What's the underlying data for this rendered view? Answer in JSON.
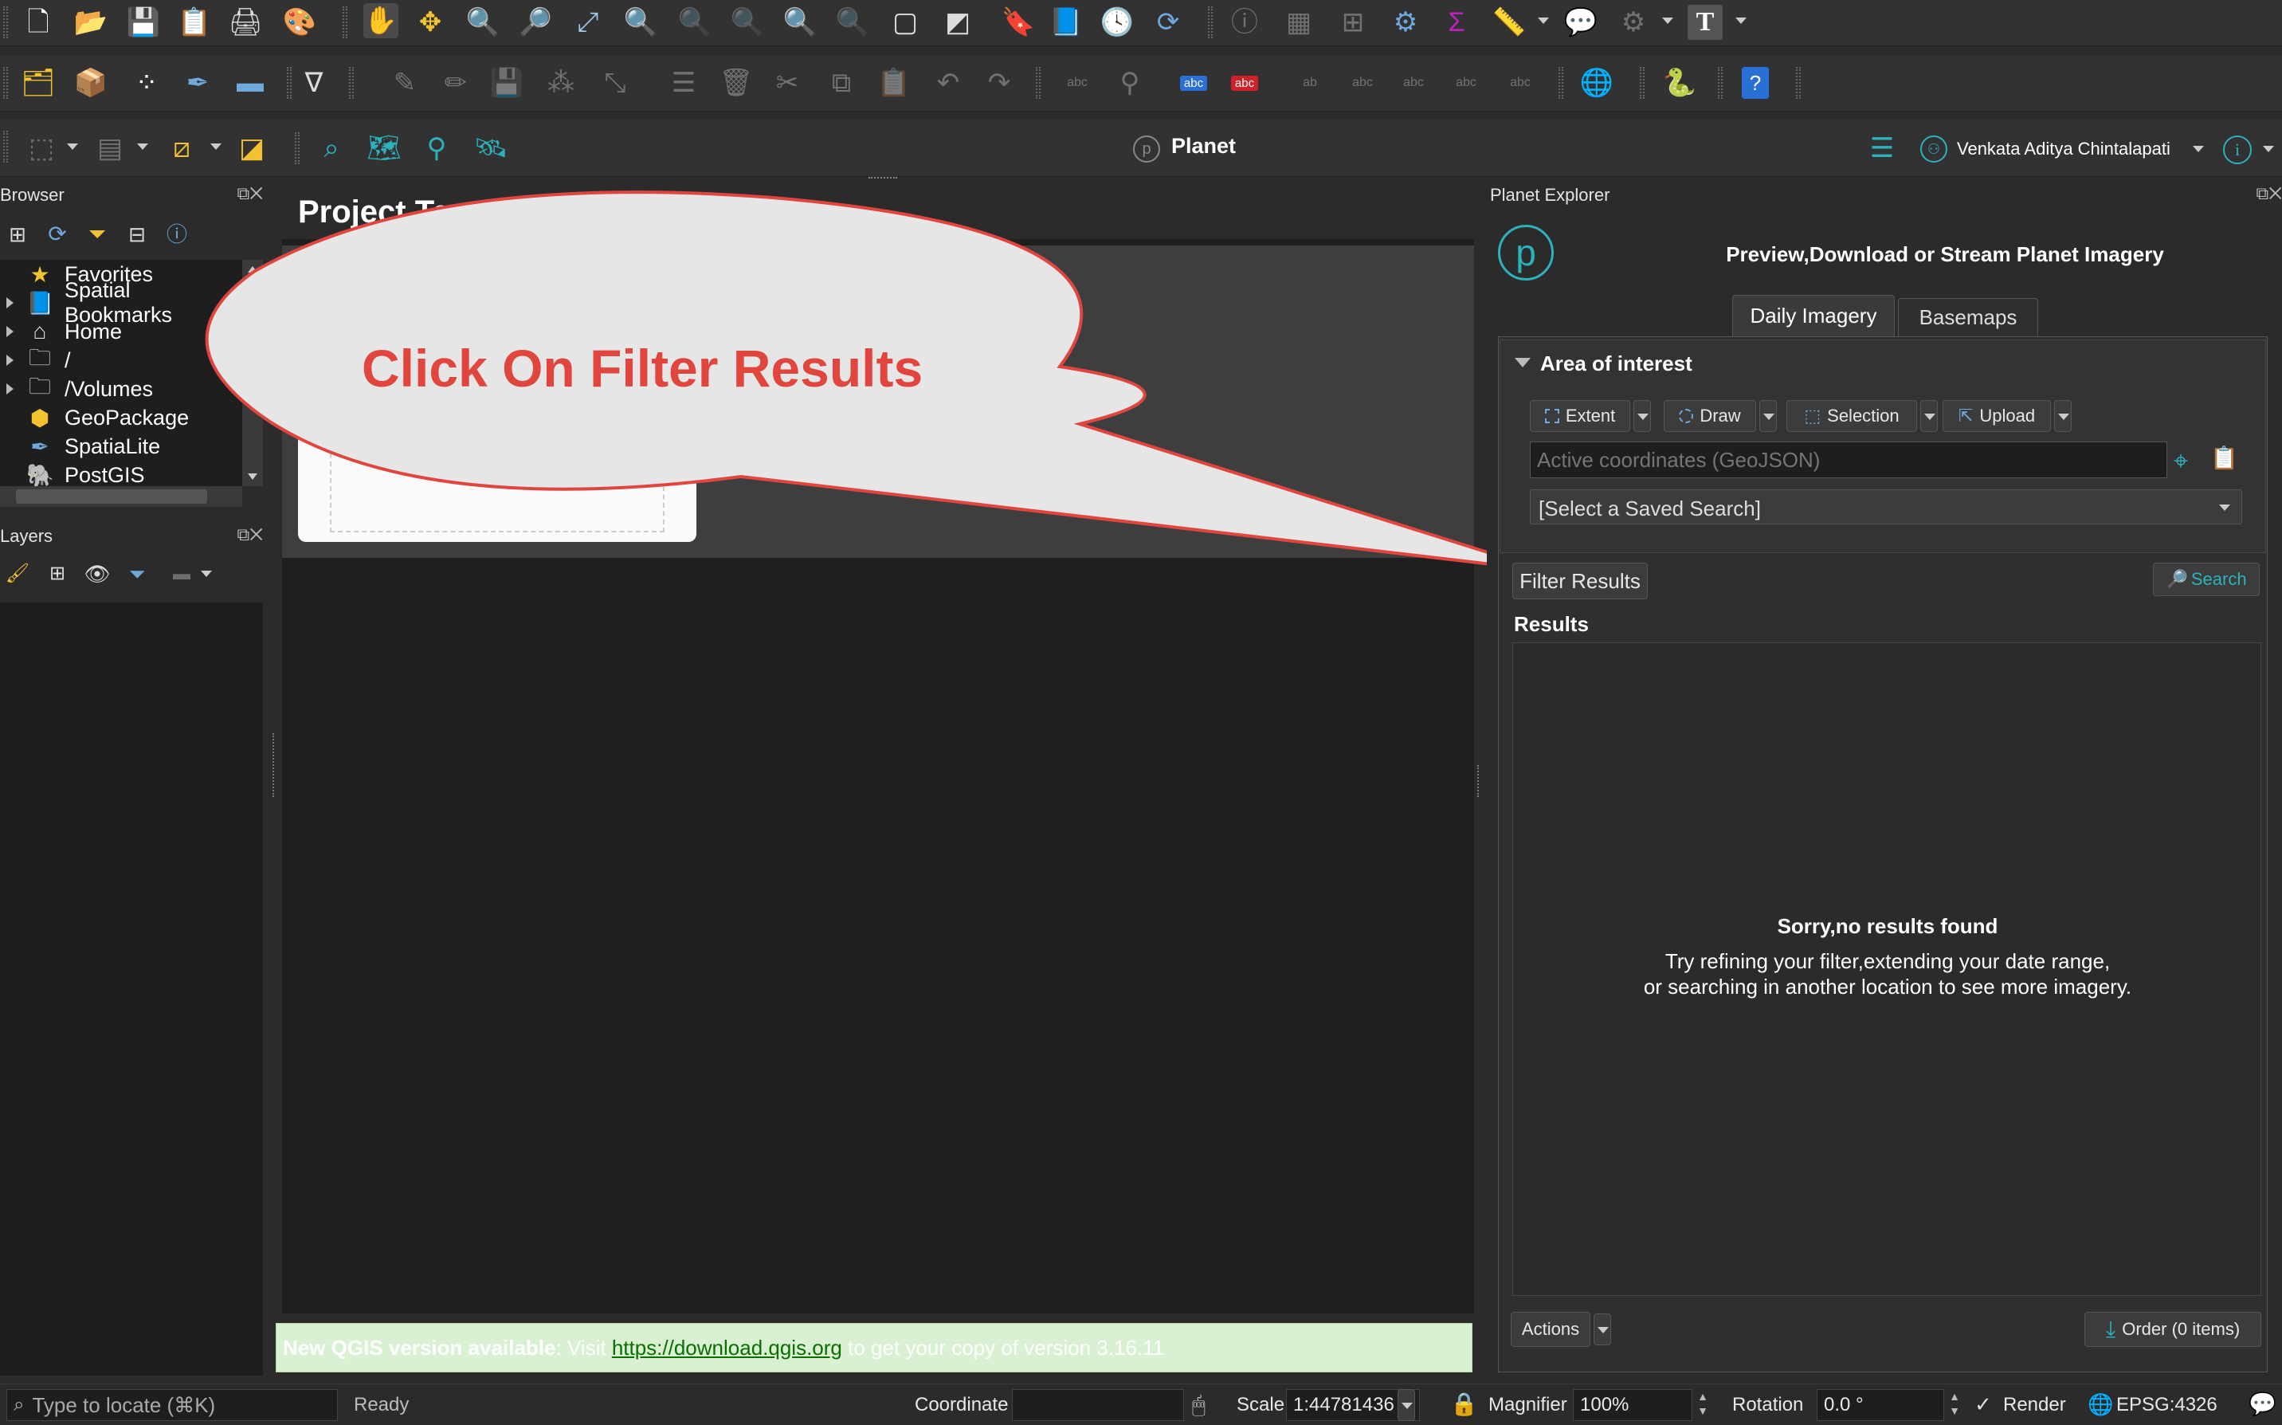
{
  "toolbar1": {
    "icons": [
      "new-project-icon",
      "open-project-icon",
      "save-project-icon",
      "new-print-layout-icon",
      "layout-manager-icon",
      "style-manager-icon",
      "pan-map-icon",
      "pan-to-selection-icon",
      "zoom-in-icon",
      "zoom-out-icon",
      "zoom-full-icon",
      "zoom-to-selection-icon",
      "zoom-to-layer-icon",
      "zoom-native-icon",
      "zoom-last-icon",
      "zoom-next-icon",
      "new-map-view-icon",
      "new-3d-view-icon",
      "new-bookmark-icon",
      "show-bookmarks-icon",
      "temporal-controller-icon",
      "refresh-icon",
      "identify-icon",
      "attribute-table-icon",
      "field-calculator-icon",
      "processing-toolbox-icon",
      "statistics-icon",
      "measure-icon",
      "map-tips-icon",
      "settings-gear-icon",
      "text-annotation-icon"
    ]
  },
  "toolbar2": {
    "labels": [
      "abc",
      "abc"
    ]
  },
  "plugin_bar": {
    "title": "Planet",
    "user_name": "Venkata Aditya Chintalapati"
  },
  "browser": {
    "title": "Browser",
    "items": [
      {
        "label": "Favorites",
        "icon": "star-icon"
      },
      {
        "label": "Spatial Bookmarks",
        "icon": "bookmark-icon"
      },
      {
        "label": "Home",
        "icon": "home-icon"
      },
      {
        "label": "/",
        "icon": "folder-icon"
      },
      {
        "label": "/Volumes",
        "icon": "folder-icon"
      },
      {
        "label": "GeoPackage",
        "icon": "geopackage-icon"
      },
      {
        "label": "SpatiaLite",
        "icon": "spatialite-icon"
      },
      {
        "label": "PostGIS",
        "icon": "postgis-icon"
      }
    ]
  },
  "layers": {
    "title": "Layers"
  },
  "map_area": {
    "project_templates_title": "Project Templates"
  },
  "callout": {
    "text": "Click On Filter Results"
  },
  "update_banner": {
    "bold_text": "New QGIS version available",
    "visit_text": ": Visit ",
    "link": "https://download.qgis.org",
    "suffix": " to get your copy of version 3.16.11"
  },
  "planet_explorer": {
    "title": "Planet Explorer",
    "heading": "Preview,Download or Stream Planet Imagery",
    "tabs": [
      "Daily Imagery",
      "Basemaps"
    ],
    "active_tab": "Daily Imagery",
    "area_of_interest": "Area of interest",
    "aoi_buttons": [
      "Extent",
      "Draw",
      "Selection",
      "Upload"
    ],
    "coords_placeholder": "Active coordinates (GeoJSON)",
    "saved_search": "[Select a Saved Search]",
    "filter_results_label": "Filter Results",
    "search_label": "Search",
    "results_label": "Results",
    "no_results_title": "Sorry,no results found",
    "no_results_line1": "Try refining your filter,extending your date range,",
    "no_results_line2": "or searching in another location to see more imagery.",
    "actions_label": "Actions",
    "order_label": "Order (0 items)"
  },
  "statusbar": {
    "locate_placeholder": "Type to locate (⌘K)",
    "ready": "Ready",
    "coordinate_label": "Coordinate",
    "coordinate_value": "",
    "scale_label": "Scale",
    "scale_value": "1:44781436",
    "magnifier_label": "Magnifier",
    "magnifier_value": "100%",
    "rotation_label": "Rotation",
    "rotation_value": "0.0 °",
    "render_label": "Render",
    "crs": "EPSG:4326"
  },
  "colors": {
    "accent_teal": "#2cb2bd",
    "callout_text": "#e0463e",
    "callout_fill": "#e6e6e6",
    "banner_bg": "#d9f1d2",
    "link_green": "#0a6e00"
  }
}
